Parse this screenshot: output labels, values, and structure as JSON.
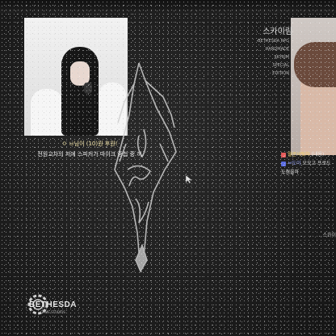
{
  "overlay": {
    "left_caption": {
      "line1": "ㅇ ㅂ님이 (10)원 후원!",
      "line2": "전원교차의 저에 스피커가 마이크 중첩 중 꺼"
    },
    "right_panel": {
      "title": "스카이림",
      "lines": [
        "BETHESDA RPG",
        "HANDMADE",
        "SKYRIM",
        "SPECIAL EDITION"
      ]
    },
    "chat": [
      {
        "name": "월문의떳자",
        "text": "(내용)"
      },
      {
        "name": "ㅂ도이",
        "text": "으으고 프로드"
      },
      {
        "name": "",
        "text": "도점을하"
      }
    ],
    "side_bottom": "스카이"
  },
  "logo": {
    "word": "BETHESDA",
    "sub": "GAME STUDIOS"
  },
  "colors": {
    "background": "#1c1c1c",
    "caption_highlight": "#f6e7a9",
    "chat_name_1": "#f2d36b",
    "chat_name_2": "#9aa8ff"
  },
  "icons": [
    "skyrim-dragon-logo",
    "bethesda-gear-icon",
    "mouse-cursor-icon"
  ]
}
